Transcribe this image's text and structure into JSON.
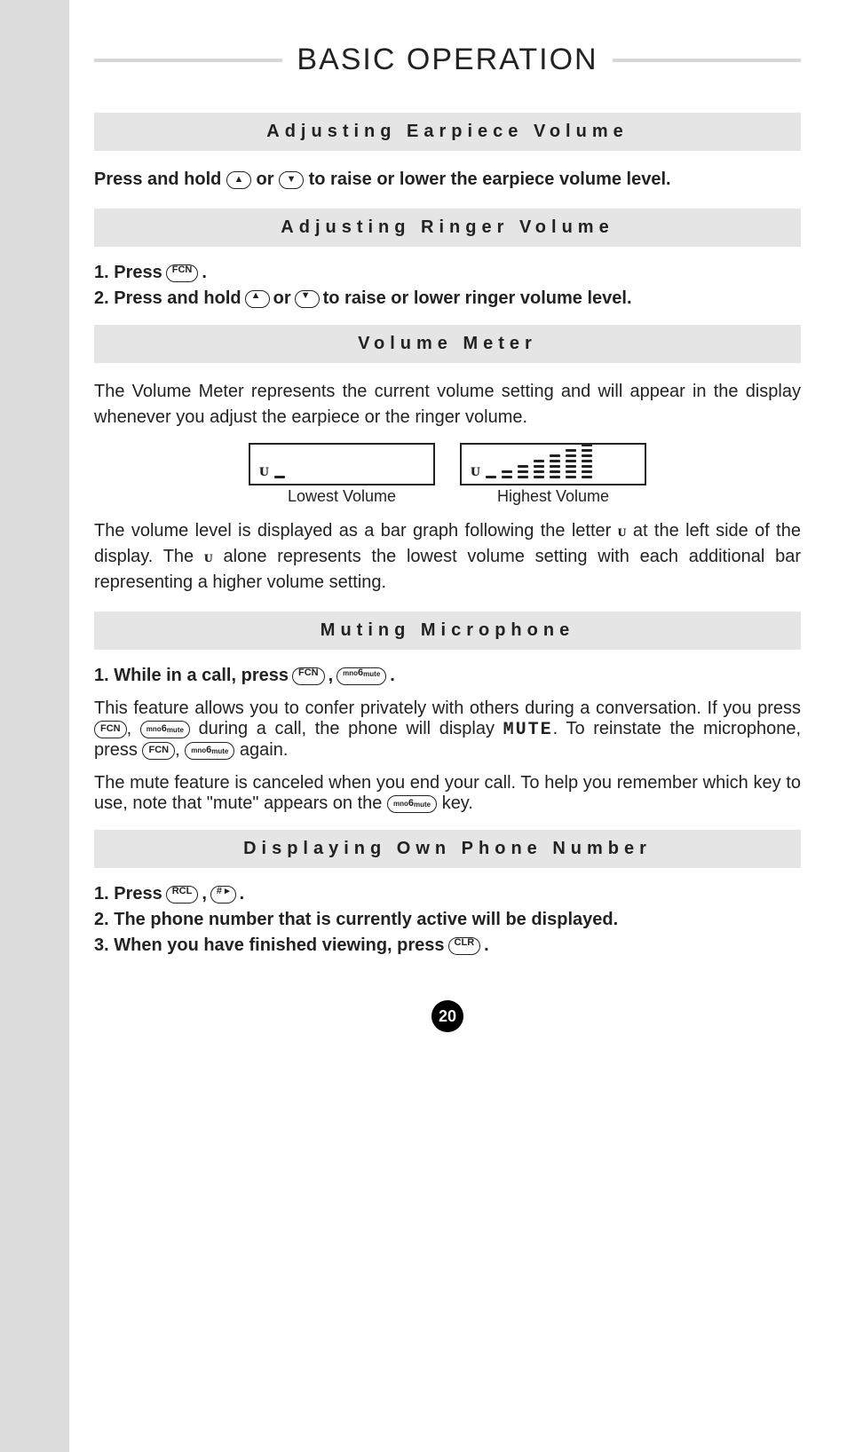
{
  "page_title": "BASIC OPERATION",
  "sections": {
    "adj_earpiece": {
      "title": "Adjusting Earpiece Volume",
      "body_pre": "Press and hold ",
      "body_mid": " or ",
      "body_post": " to raise or lower the earpiece volume level."
    },
    "adj_ringer": {
      "title": "Adjusting Ringer Volume",
      "step1_pre": "1. Press ",
      "step1_post": ".",
      "step2_pre": "2. Press and hold ",
      "step2_mid": " or ",
      "step2_post": " to raise or lower ringer volume level."
    },
    "volume_meter": {
      "title": "Volume Meter",
      "para1": "The Volume Meter represents the current volume setting and will appear in the display whenever you adjust the earpiece or the ringer volume.",
      "lcd_low_caption": "Lowest Volume",
      "lcd_high_caption": "Highest Volume",
      "para2_pre": "The volume level is displayed as a bar graph following the letter ",
      "para2_mid1": " at the left side of the display. The ",
      "para2_mid2": " alone represents the lowest volume setting with each additional bar representing a higher volume setting."
    },
    "muting": {
      "title": "Muting Microphone",
      "step1_pre": "1. While in a call, press ",
      "step1_sep": ", ",
      "step1_post": ".",
      "para_a_pre": "This feature allows you to confer privately with others during a conversation. If you press ",
      "para_a_sep": ", ",
      "para_a_mid": " during a call, the phone will display ",
      "mute_display": "MUTE",
      "para_a_mid2": ". To reinstate the microphone, press ",
      "para_a_sep2": ", ",
      "para_a_post": " again.",
      "para_b_pre": "The mute feature is canceled when you end your call. To help you remember which key to use, note that \"mute\" appears on the ",
      "para_b_post": " key."
    },
    "display_own": {
      "title": "Displaying Own Phone Number",
      "step1_pre": "1. Press ",
      "step1_sep": ", ",
      "step1_post": ".",
      "step2": "2. The phone number that is currently active will be displayed.",
      "step3_pre": "3. When you have finished viewing, press ",
      "step3_post": "."
    }
  },
  "keys": {
    "fcn": "FCN",
    "rcl": "RCL",
    "clr": "CLR",
    "hash": "# ▸",
    "six_main": "6",
    "six_super": "mno",
    "six_sub": "mute",
    "v_glyph": "ᴜ"
  },
  "page_number": "20"
}
